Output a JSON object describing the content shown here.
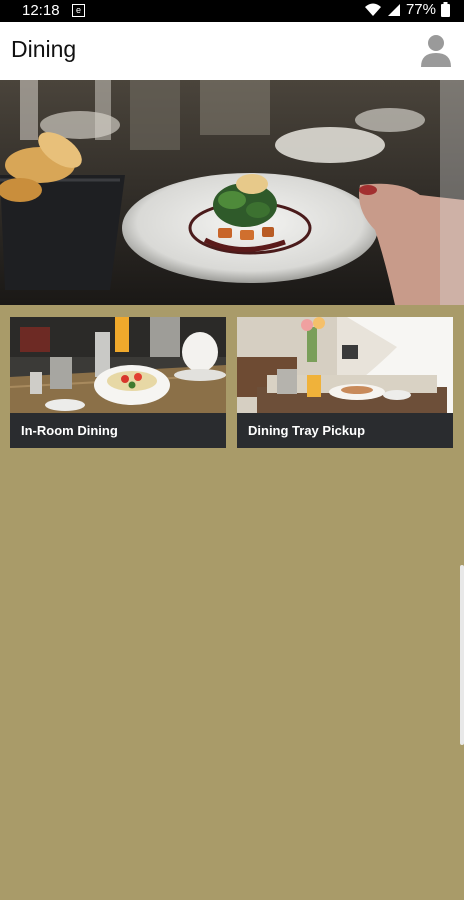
{
  "status_bar": {
    "time": "12:18",
    "notification_icon": "e",
    "battery_percent": "77%",
    "icons": [
      "wifi-icon",
      "signal-icon",
      "battery-icon"
    ]
  },
  "app_bar": {
    "title": "Dining",
    "profile_icon": "person-icon"
  },
  "hero": {
    "image_description_icon": "plated-dish-photo"
  },
  "tiles": [
    {
      "label": "In-Room Dining",
      "image_icon": "breakfast-table-photo"
    },
    {
      "label": "Dining Tray Pickup",
      "image_icon": "room-tray-photo"
    }
  ],
  "colors": {
    "background": "#a99b69",
    "caption_bg": "#2a2c2f",
    "app_bar_bg": "#ffffff",
    "status_bar_bg": "#000000"
  }
}
